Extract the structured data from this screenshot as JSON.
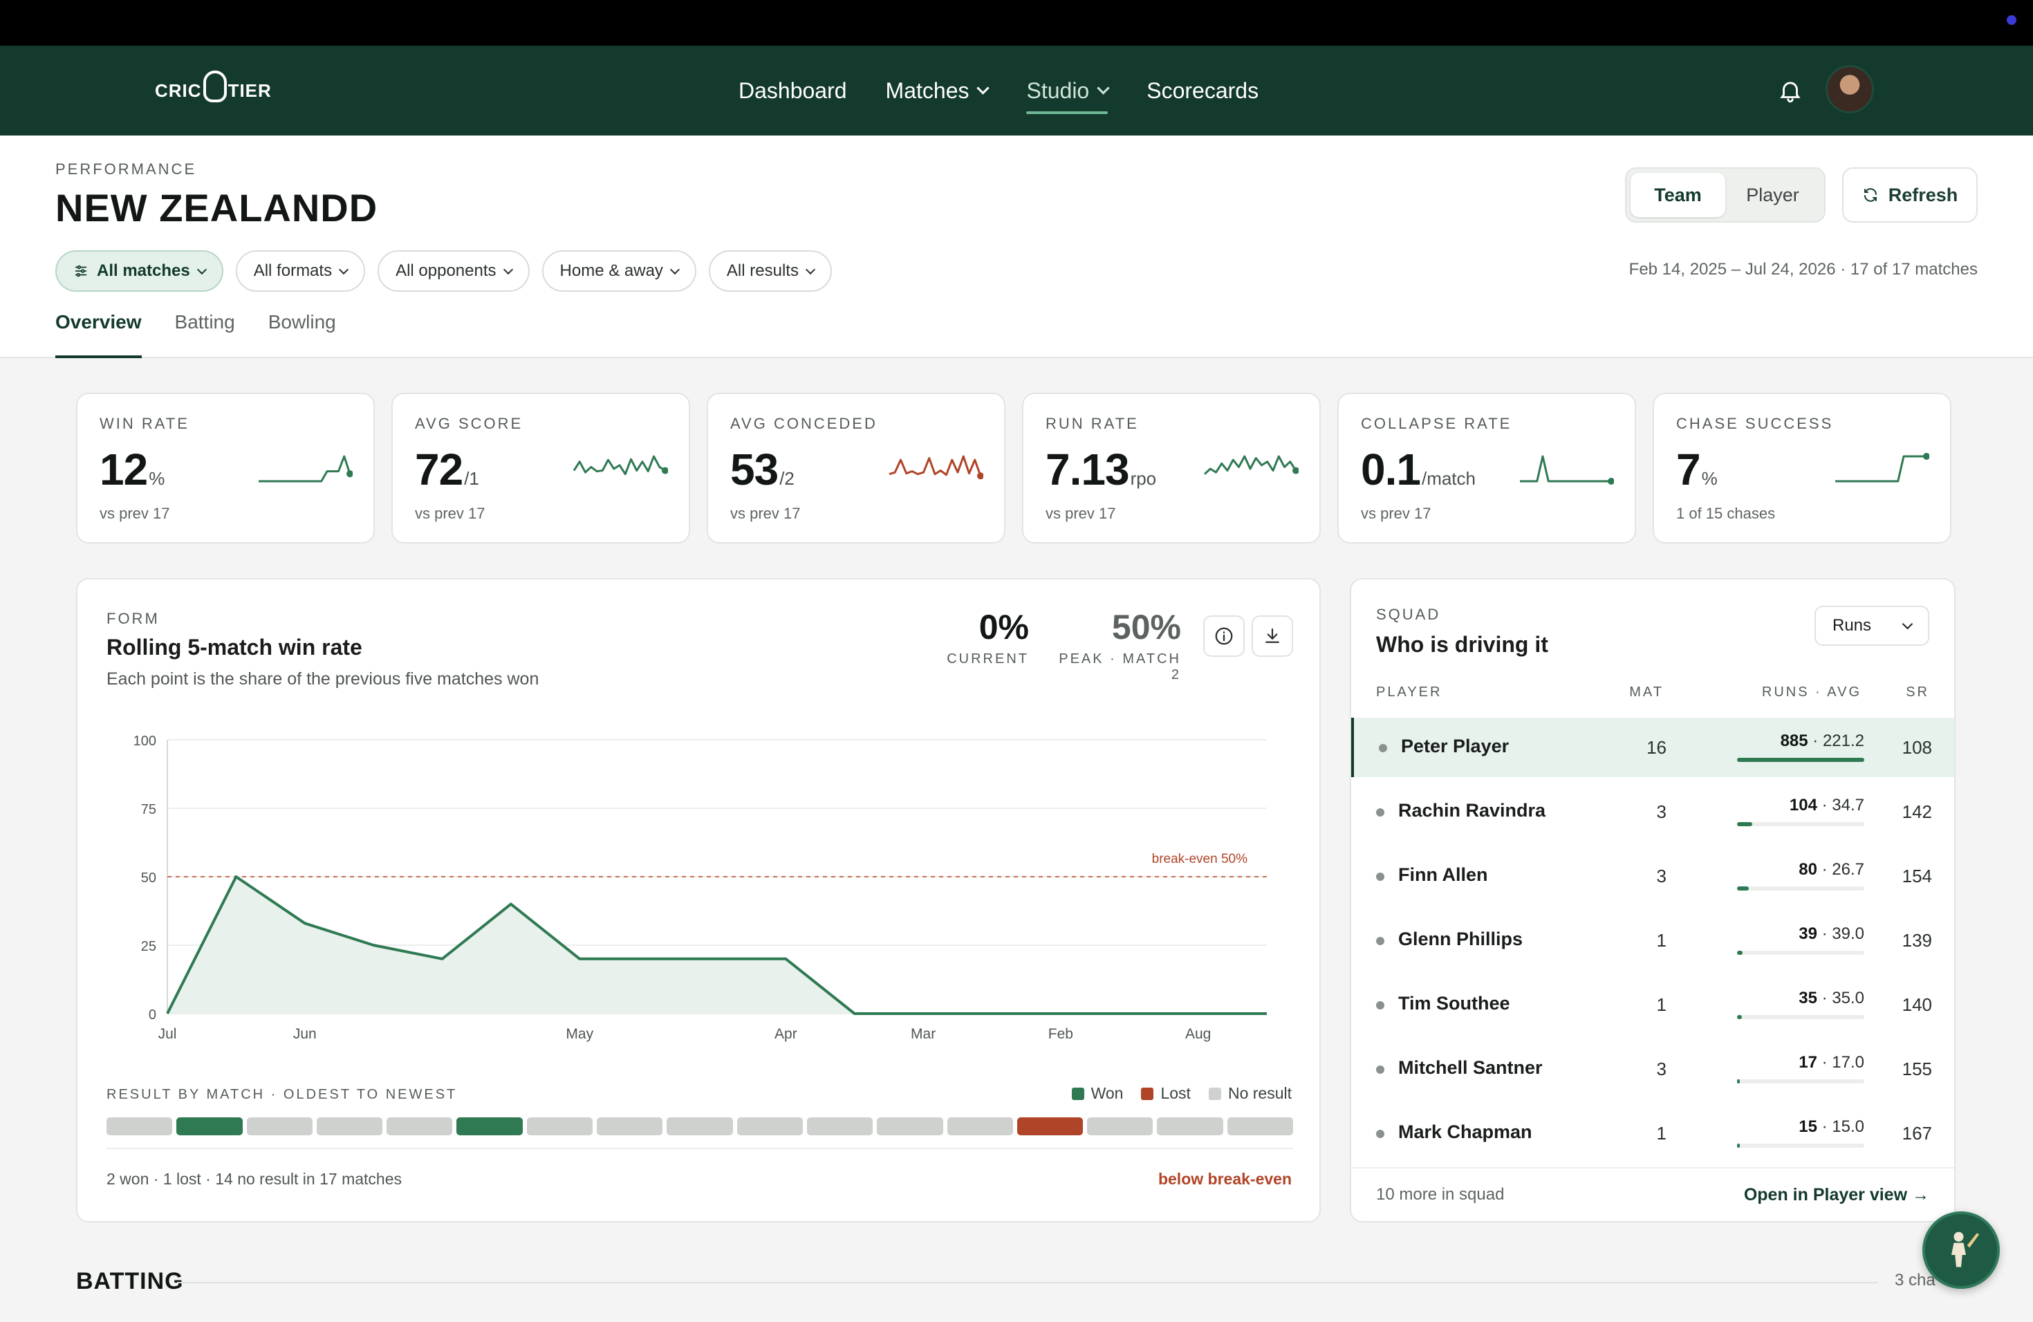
{
  "brand": {
    "logo_text_left": "CRIC",
    "logo_text_right": "TIER"
  },
  "nav": {
    "links": [
      {
        "label": "Dashboard"
      },
      {
        "label": "Matches"
      },
      {
        "label": "Studio"
      },
      {
        "label": "Scorecards"
      }
    ],
    "active": "Studio"
  },
  "header": {
    "eyebrow": "PERFORMANCE",
    "title": "NEW ZEALANDD",
    "toggle": {
      "team": "Team",
      "player": "Player",
      "selected": "Team"
    },
    "refresh": "Refresh",
    "filters": [
      "All matches",
      "All formats",
      "All opponents",
      "Home & away",
      "All results"
    ],
    "daterange": "Feb 14, 2025 – Jul 24, 2026 · 17 of 17 matches",
    "tabs": [
      "Overview",
      "Batting",
      "Bowling"
    ],
    "active_tab": "Overview"
  },
  "kpis": [
    {
      "label": "WIN RATE",
      "value": "12",
      "unit": "%",
      "sub": "vs prev 17",
      "color": "#2f7a53",
      "spark": [
        0,
        0,
        0,
        0,
        0,
        0,
        0,
        0,
        0,
        0,
        0,
        0,
        20,
        20,
        20,
        50,
        15
      ]
    },
    {
      "label": "AVG SCORE",
      "value": "72",
      "unit": "/1",
      "sub": "vs prev 17",
      "color": "#2f7a53",
      "spark": [
        30,
        55,
        25,
        40,
        28,
        30,
        60,
        35,
        45,
        20,
        62,
        30,
        55,
        28,
        70,
        40,
        30
      ]
    },
    {
      "label": "AVG CONCEDED",
      "value": "53",
      "unit": "/2",
      "sub": "vs prev 17",
      "color": "#b04428",
      "spark": [
        20,
        25,
        60,
        22,
        28,
        20,
        25,
        65,
        20,
        30,
        18,
        60,
        25,
        70,
        22,
        60,
        15
      ]
    },
    {
      "label": "RUN RATE",
      "value": "7.13",
      "unit": "rpo",
      "sub": "vs prev 17",
      "color": "#2f7a53",
      "spark": [
        20,
        35,
        25,
        50,
        30,
        60,
        40,
        70,
        35,
        65,
        45,
        55,
        30,
        70,
        40,
        55,
        30
      ]
    },
    {
      "label": "COLLAPSE RATE",
      "value": "0.1",
      "unit": "/match",
      "sub": "vs prev 17",
      "color": "#2f7a53",
      "spark": [
        0,
        0,
        0,
        0,
        100,
        0,
        0,
        0,
        0,
        0,
        0,
        0,
        0,
        0,
        0,
        0,
        0
      ]
    },
    {
      "label": "CHASE SUCCESS",
      "value": "7",
      "unit": "%",
      "sub": "1 of 15 chases",
      "color": "#2f7a53",
      "spark": [
        0,
        0,
        0,
        0,
        0,
        0,
        0,
        0,
        0,
        0,
        0,
        0,
        60,
        60,
        60,
        60,
        60
      ]
    }
  ],
  "form": {
    "eyebrow": "FORM",
    "title": "Rolling 5-match win rate",
    "desc": "Each point is the share of the previous five matches won",
    "current_value": "0%",
    "current_label": "CURRENT",
    "peak_value": "50%",
    "peak_label": "PEAK · MATCH 2",
    "icons": [
      "info-icon",
      "download-icon"
    ],
    "results_head": "RESULT BY MATCH · OLDEST TO NEWEST",
    "legend": {
      "won": "Won",
      "lost": "Lost",
      "no_result": "No result"
    },
    "results": [
      "N",
      "W",
      "N",
      "N",
      "N",
      "W",
      "N",
      "N",
      "N",
      "N",
      "N",
      "N",
      "N",
      "L",
      "N",
      "N",
      "N"
    ],
    "summary": "2 won · 1 lost · 14 no result in 17 matches",
    "status": "below break-even",
    "colors": {
      "won": "#2f7a53",
      "lost": "#b04428",
      "none": "#cfd1cf"
    }
  },
  "chart_data": {
    "type": "area",
    "title": "Rolling 5-match win rate",
    "xlabel": "",
    "ylabel": "",
    "ylim": [
      0,
      100
    ],
    "yticks": [
      "0",
      "25",
      "50",
      "75",
      "100"
    ],
    "x_tick_labels": [
      {
        "match": 1,
        "label": "Jul"
      },
      {
        "match": 3,
        "label": "Jun"
      },
      {
        "match": 7,
        "label": "May"
      },
      {
        "match": 10,
        "label": "Apr"
      },
      {
        "match": 12,
        "label": "Mar"
      },
      {
        "match": 14,
        "label": "Feb"
      },
      {
        "match": 16,
        "label": "Aug"
      }
    ],
    "x": [
      1,
      2,
      3,
      4,
      5,
      6,
      7,
      8,
      9,
      10,
      11,
      12,
      13,
      14,
      15,
      16,
      17
    ],
    "values": [
      0,
      50,
      33,
      25,
      20,
      40,
      20,
      20,
      20,
      20,
      0,
      0,
      0,
      0,
      0,
      0,
      0
    ],
    "reference_line": {
      "value": 50,
      "label": "break-even 50%"
    },
    "grid": true
  },
  "squad": {
    "eyebrow": "SQUAD",
    "title": "Who is driving it",
    "metric": "Runs",
    "headers": {
      "player": "PLAYER",
      "mat": "MAT",
      "runs": "RUNS · AVG",
      "sr": "SR"
    },
    "rows": [
      {
        "name": "Peter Player",
        "mat": "16",
        "runs": "885",
        "avg": "221.2",
        "sr": "108",
        "share": 1.0
      },
      {
        "name": "Rachin Ravindra",
        "mat": "3",
        "runs": "104",
        "avg": "34.7",
        "sr": "142",
        "share": 0.118
      },
      {
        "name": "Finn Allen",
        "mat": "3",
        "runs": "80",
        "avg": "26.7",
        "sr": "154",
        "share": 0.09
      },
      {
        "name": "Glenn Phillips",
        "mat": "1",
        "runs": "39",
        "avg": "39.0",
        "sr": "139",
        "share": 0.044
      },
      {
        "name": "Tim Southee",
        "mat": "1",
        "runs": "35",
        "avg": "35.0",
        "sr": "140",
        "share": 0.04
      },
      {
        "name": "Mitchell Santner",
        "mat": "3",
        "runs": "17",
        "avg": "17.0",
        "sr": "155",
        "share": 0.019
      },
      {
        "name": "Mark Chapman",
        "mat": "1",
        "runs": "15",
        "avg": "15.0",
        "sr": "167",
        "share": 0.017
      }
    ],
    "more": "10 more in squad",
    "link": "Open in Player view"
  },
  "batting_section": {
    "title": "BATTING",
    "meta": "3 cha"
  }
}
